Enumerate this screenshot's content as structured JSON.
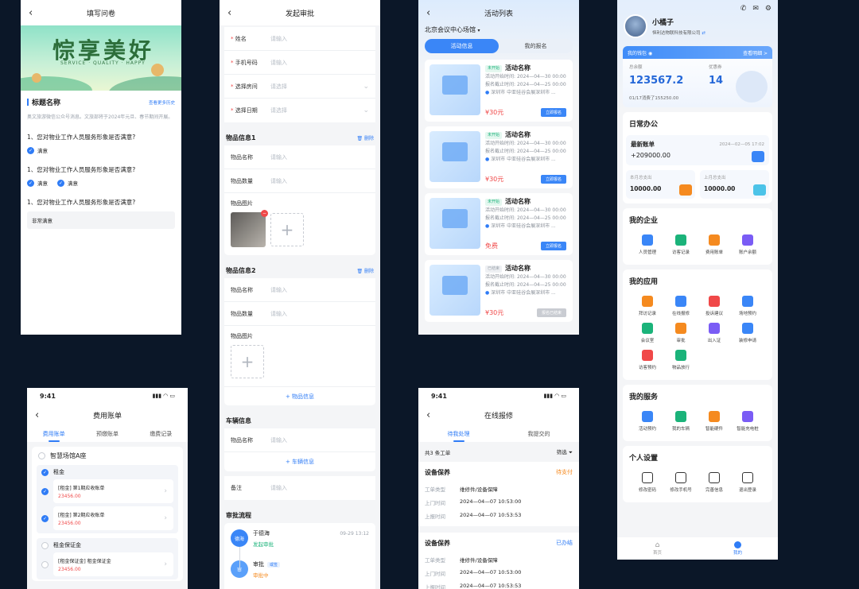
{
  "p1": {
    "nav_title": "填写问卷",
    "banner_title": "悰享美好",
    "banner_sub": "SERVICE · QUALITY · HAPPY",
    "section_title": "标题名称",
    "history_link": "查看更多历史",
    "desc": "奥文旅游微信公众号消息。文旅部将于2024年元旦、春节期间开展。",
    "q1": "1、您对物业工作人员服务形象是否满意?",
    "q1_opt": "满意",
    "q2": "1、您对物业工作人员服务形象是否满意?",
    "q2_opts": [
      "满意",
      "满意"
    ],
    "q3": "1、您对物业工作人员服务形象是否满意?",
    "q3_answer": "非常满意"
  },
  "p2": {
    "nav_title": "发起审批",
    "fields": [
      {
        "label": "姓名",
        "ph": "请输入",
        "req": true
      },
      {
        "label": "手机号码",
        "ph": "请输入",
        "req": true
      },
      {
        "label": "选择房间",
        "ph": "请选择",
        "req": true
      },
      {
        "label": "选择日期",
        "ph": "请选择",
        "req": true
      }
    ],
    "item1_title": "物品信息1",
    "item2_title": "物品信息2",
    "delete": "删除",
    "item_name": "物品名称",
    "item_qty": "物品数量",
    "item_img": "物品图片",
    "ph_input": "请输入",
    "add_item": "+ 物品信息",
    "vehicle_title": "车辆信息",
    "add_vehicle": "+ 车辆信息",
    "remark": "备注",
    "flow_title": "审批流程",
    "flow": [
      {
        "avatar": "德海",
        "name": "于德海",
        "status": "发起审批",
        "time": "09-29 13:12"
      },
      {
        "avatar": "审",
        "name": "审批",
        "tag": "或签",
        "status": "审批中",
        "time": ""
      }
    ]
  },
  "p3": {
    "nav_title": "活动列表",
    "location": "北京会议中心场馆",
    "tabs": [
      "活动信息",
      "我的报名"
    ],
    "start_label": "活动开始时间:",
    "end_label": "报名截止时间:",
    "start_time": "2024—04—30 00:00",
    "end_time": "2024—04—25 00:00",
    "addr": "深圳市 中亚硅谷会展深圳市 ...",
    "items": [
      {
        "tag": "未开始",
        "name": "活动名称",
        "price": "¥30元",
        "btn": "立即报名",
        "disabled": false
      },
      {
        "tag": "未开始",
        "name": "活动名称",
        "price": "¥30元",
        "btn": "立即报名",
        "disabled": false
      },
      {
        "tag": "未开始",
        "name": "活动名称",
        "price": "免费",
        "btn": "立即报名",
        "disabled": false
      },
      {
        "tag": "已结束",
        "name": "活动名称",
        "price": "¥30元",
        "btn": "报名已结束",
        "disabled": true
      }
    ]
  },
  "p4": {
    "name": "小橘子",
    "company": "恒利达物联科技有限公司",
    "wallet": "我的钱包",
    "wallet_link": "查看明细 >",
    "balance_label": "总余额",
    "balance": "123567.2",
    "coupon_label": "优惠券",
    "coupon": "14",
    "spent": "01/17消费了155250.00",
    "office_title": "日常办公",
    "latest_label": "最新账单",
    "latest_date": "2024—02—05 17:02",
    "latest_amount": "+209000.00",
    "month_label": "本月总支出",
    "month_amount": "10000.00",
    "last_label": "上月总支出",
    "last_amount": "10000.00",
    "ent_title": "我的企业",
    "ent": [
      {
        "icon": "user-manage-icon",
        "label": "人员管理",
        "color": "#3a86f7"
      },
      {
        "icon": "visit-record-icon",
        "label": "访客记录",
        "color": "#1bb37a"
      },
      {
        "icon": "bill-icon",
        "label": "费用账单",
        "color": "#f58a1f"
      },
      {
        "icon": "account-balance-icon",
        "label": "账户余额",
        "color": "#7a5cf5"
      }
    ],
    "app_title": "我的应用",
    "apps": [
      {
        "icon": "visit-icon",
        "label": "拜访记录",
        "color": "#f58a1f"
      },
      {
        "icon": "repair-icon",
        "label": "在线报修",
        "color": "#3a86f7"
      },
      {
        "icon": "complaint-icon",
        "label": "投诉建议",
        "color": "#f04848"
      },
      {
        "icon": "venue-icon",
        "label": "场地预约",
        "color": "#3a86f7"
      },
      {
        "icon": "meeting-room-icon",
        "label": "会议室",
        "color": "#1bb37a"
      },
      {
        "icon": "approval-icon",
        "label": "审批",
        "color": "#f58a1f"
      },
      {
        "icon": "pass-icon",
        "label": "出入证",
        "color": "#7a5cf5"
      },
      {
        "icon": "decoration-icon",
        "label": "装修申请",
        "color": "#3a86f7"
      },
      {
        "icon": "visitor-icon",
        "label": "访客预约",
        "color": "#f04848"
      },
      {
        "icon": "release-icon",
        "label": "物品放行",
        "color": "#1bb37a"
      }
    ],
    "service_title": "我的服务",
    "services": [
      {
        "icon": "activity-icon",
        "label": "活动预约",
        "color": "#3a86f7"
      },
      {
        "icon": "car-icon",
        "label": "我的车辆",
        "color": "#1bb37a"
      },
      {
        "icon": "hardware-icon",
        "label": "智能硬件",
        "color": "#f58a1f"
      },
      {
        "icon": "charging-icon",
        "label": "智能充电桩",
        "color": "#7a5cf5"
      }
    ],
    "settings_title": "个人设置",
    "settings": [
      {
        "icon": "lock-icon",
        "label": "修改密码"
      },
      {
        "icon": "phone-icon",
        "label": "修改手机号"
      },
      {
        "icon": "info-icon",
        "label": "完善信息"
      },
      {
        "icon": "power-icon",
        "label": "退出登录"
      }
    ],
    "tab_home": "首页",
    "tab_mine": "我的"
  },
  "p5": {
    "time": "9:41",
    "nav_title": "费用账单",
    "tabs": [
      "费用账单",
      "预缴账单",
      "缴费记录"
    ],
    "building": "智慧场馆A座",
    "group1": "租金",
    "bills": [
      {
        "title": "[租金] 第1期应收账单",
        "amount": "23456.00"
      },
      {
        "title": "[租金] 第2期应收账单",
        "amount": "23456.00"
      }
    ],
    "group2": "租金保证金",
    "bill3": {
      "title": "[租金保证金] 租金保证金",
      "amount": "23456.00"
    }
  },
  "p6": {
    "time": "9:41",
    "nav_title": "在线报修",
    "tabs": [
      "待我处理",
      "我提交的"
    ],
    "count": "共3 条工单",
    "filter": "筛选",
    "orders": [
      {
        "title": "设备保养",
        "status": "待支付",
        "type": "维修件/设备保障",
        "visit": "2024—04—07 10:53:00",
        "report": "2024—04—07 10:53:53"
      },
      {
        "title": "设备保养",
        "status": "已办结",
        "type": "维修件/设备保障",
        "visit": "2024—04—07 10:53:00",
        "report": "2024—04—07 10:53:53"
      }
    ],
    "lbl_type": "工单类型",
    "lbl_visit": "上门时间",
    "lbl_report": "上报时间"
  }
}
